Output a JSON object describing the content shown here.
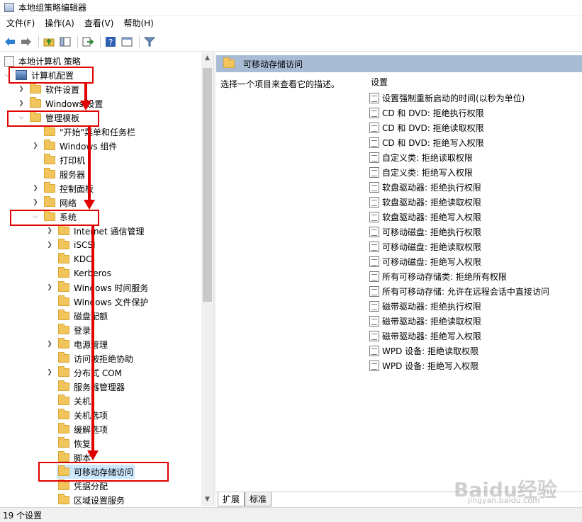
{
  "window": {
    "title": "本地组策略编辑器"
  },
  "menu": [
    "文件(F)",
    "操作(A)",
    "查看(V)",
    "帮助(H)"
  ],
  "toolbar_icons": [
    "back-icon",
    "forward-icon",
    "up-folder-icon",
    "show-tree-icon",
    "export-icon",
    "help-icon",
    "properties-icon",
    "filter-icon"
  ],
  "tree": {
    "root": "本地计算机 策略",
    "computer_config": "计算机配置",
    "software_settings": "软件设置",
    "windows_settings": "Windows 设置",
    "admin_templates": "管理模板",
    "items_l2": [
      "\"开始\"菜单和任务栏",
      "Windows 组件",
      "打印机",
      "服务器",
      "控制面板",
      "网络"
    ],
    "system": "系统",
    "system_children": [
      "Internet 通信管理",
      "iSCSI",
      "KDC",
      "Kerberos",
      "Windows 时间服务",
      "Windows 文件保护",
      "磁盘配额",
      "登录",
      "电源管理",
      "访问被拒绝协助",
      "分布式 COM",
      "服务器管理器",
      "关机",
      "关机选项",
      "缓解选项",
      "恢复",
      "脚本",
      "可移动存储访问",
      "凭据分配",
      "区域设置服务"
    ]
  },
  "right": {
    "header": "可移动存储访问",
    "description": "选择一个项目来查看它的描述。",
    "column": "设置",
    "settings": [
      "设置强制重新启动的时间(以秒为单位)",
      "CD 和 DVD: 拒绝执行权限",
      "CD 和 DVD: 拒绝读取权限",
      "CD 和 DVD: 拒绝写入权限",
      "自定义类: 拒绝读取权限",
      "自定义类: 拒绝写入权限",
      "软盘驱动器: 拒绝执行权限",
      "软盘驱动器: 拒绝读取权限",
      "软盘驱动器: 拒绝写入权限",
      "可移动磁盘: 拒绝执行权限",
      "可移动磁盘: 拒绝读取权限",
      "可移动磁盘: 拒绝写入权限",
      "所有可移动存储类: 拒绝所有权限",
      "所有可移动存储: 允许在远程会话中直接访问",
      "磁带驱动器: 拒绝执行权限",
      "磁带驱动器: 拒绝读取权限",
      "磁带驱动器: 拒绝写入权限",
      "WPD 设备: 拒绝读取权限",
      "WPD 设备: 拒绝写入权限"
    ]
  },
  "tabs": [
    "扩展",
    "标准"
  ],
  "status": "19 个设置",
  "watermark": "Baidu经验",
  "watermark_sub": "jingyan.baidu.com",
  "accent_color": "#e00000"
}
